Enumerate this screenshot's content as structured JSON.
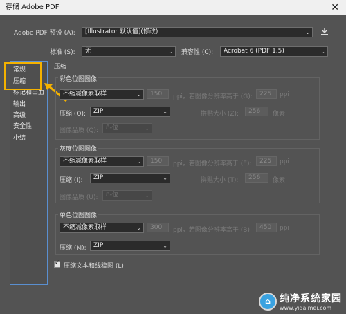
{
  "window": {
    "title": "存储 Adobe PDF",
    "close": "✕"
  },
  "preset": {
    "label": "Adobe PDF 预设 (A):",
    "value": "[Illustrator 默认值](修改)"
  },
  "standard": {
    "label": "标准 (S):",
    "value": "无"
  },
  "compat": {
    "label": "兼容性 (C):",
    "value": "Acrobat 6 (PDF 1.5)"
  },
  "sidebar": {
    "items": [
      {
        "label": "常规"
      },
      {
        "label": "压缩"
      },
      {
        "label": "标记和出血"
      },
      {
        "label": "输出"
      },
      {
        "label": "高级"
      },
      {
        "label": "安全性"
      },
      {
        "label": "小结"
      }
    ]
  },
  "section_title": "压缩",
  "color": {
    "title": "彩色位图图像",
    "downsample": "不缩减像素取样",
    "ppi1": "150",
    "ppi_unit": "ppi，若图像分辨率高于 (G):",
    "ppi2": "225",
    "ppi_unit2": "ppi",
    "compress_label": "压缩 (O):",
    "compress": "ZIP",
    "tile_label": "拼贴大小 (Z):",
    "tile": "256",
    "tile_unit": "像素",
    "quality_label": "图像品质 (Q):",
    "quality": "8-位"
  },
  "gray": {
    "title": "灰度位图图像",
    "downsample": "不缩减像素取样",
    "ppi1": "150",
    "ppi_unit": "ppi，若图像分辨率高于 (E):",
    "ppi2": "225",
    "ppi_unit2": "ppi",
    "compress_label": "压缩 (I):",
    "compress": "ZIP",
    "tile_label": "拼贴大小 (T):",
    "tile": "256",
    "tile_unit": "像素",
    "quality_label": "图像品质 (U):",
    "quality": "8-位"
  },
  "mono": {
    "title": "单色位图图像",
    "downsample": "不缩减像素取样",
    "ppi1": "300",
    "ppi_unit": "ppi，若图像分辨率高于 (B):",
    "ppi2": "450",
    "ppi_unit2": "ppi",
    "compress_label": "压缩 (M):",
    "compress": "ZIP"
  },
  "compress_text": "压缩文本和线稿图 (L)",
  "watermark": {
    "logo": "⌂",
    "title": "纯净系统家园",
    "url": "www.yidaimei.com"
  },
  "colors": {
    "highlight": "#f5b200",
    "sidebar_border": "#5a8fd0"
  }
}
